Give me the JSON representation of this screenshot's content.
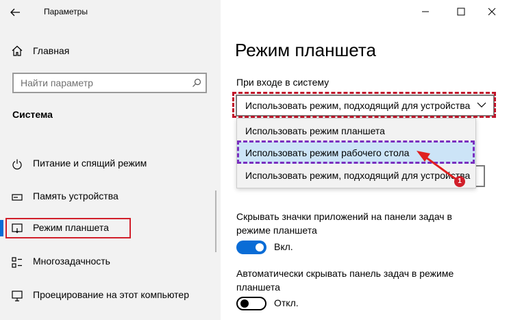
{
  "window": {
    "title": "Параметры"
  },
  "sidebar": {
    "home_label": "Главная",
    "search_placeholder": "Найти параметр",
    "section_title": "Система",
    "items": [
      {
        "label": "Питание и спящий режим",
        "icon": "power-icon"
      },
      {
        "label": "Память устройства",
        "icon": "storage-icon"
      },
      {
        "label": "Режим планшета",
        "icon": "tablet-mode-icon",
        "selected": true
      },
      {
        "label": "Многозадачность",
        "icon": "multitasking-icon"
      },
      {
        "label": "Проецирование на этот компьютер",
        "icon": "projecting-icon"
      }
    ]
  },
  "main": {
    "page_title": "Режим планшета",
    "signin_label": "При входе в систему",
    "signin_value": "Использовать режим, подходящий для устройства",
    "dropdown_options": [
      "Использовать режим планшета",
      "Использовать режим рабочего стола",
      "Использовать режим, подходящий для устройства"
    ],
    "hide_icons_label": "Скрывать значки приложений на панели задач в режиме планшета",
    "hide_icons_state": "Вкл.",
    "hide_taskbar_label": "Автоматически скрывать панель задач в режиме планшета",
    "hide_taskbar_state": "Откл."
  },
  "annotation": {
    "badge": "1"
  },
  "colors": {
    "accent": "#0a6cd6",
    "selected_option": "#cce4f7",
    "highlight_red": "#d11f2a",
    "highlight_purple": "#7a2fbf"
  }
}
